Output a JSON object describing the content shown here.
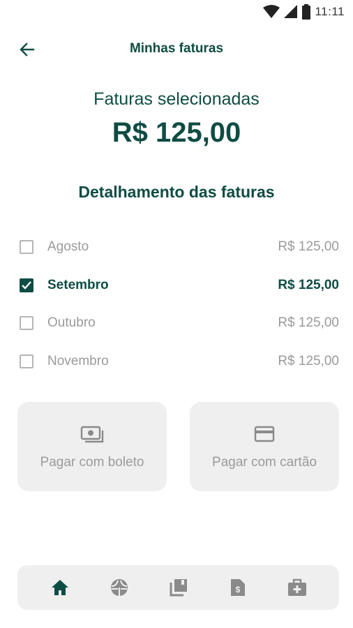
{
  "status_bar": {
    "time": "11:11"
  },
  "app_bar": {
    "title": "Minhas faturas"
  },
  "summary": {
    "label": "Faturas selecionadas",
    "amount": "R$ 125,00"
  },
  "details": {
    "title": "Detalhamento das faturas",
    "items": [
      {
        "month": "Agosto",
        "value": "R$ 125,00",
        "checked": false
      },
      {
        "month": "Setembro",
        "value": "R$ 125,00",
        "checked": true
      },
      {
        "month": "Outubro",
        "value": "R$ 125,00",
        "checked": false
      },
      {
        "month": "Novembro",
        "value": "R$ 125,00",
        "checked": false
      }
    ]
  },
  "payment": {
    "boleto_label": "Pagar com boleto",
    "cartao_label": "Pagar com cartão",
    "boleto_icon": "cash-icon",
    "cartao_icon": "credit-card-icon"
  },
  "bottom_nav": {
    "items": [
      "home-icon",
      "sports-icon",
      "library-icon",
      "invoice-icon",
      "medical-kit-icon"
    ]
  },
  "colors": {
    "primary": "#0f4c44",
    "disabled_text": "#9a9a9a",
    "card_bg": "#efefef"
  }
}
